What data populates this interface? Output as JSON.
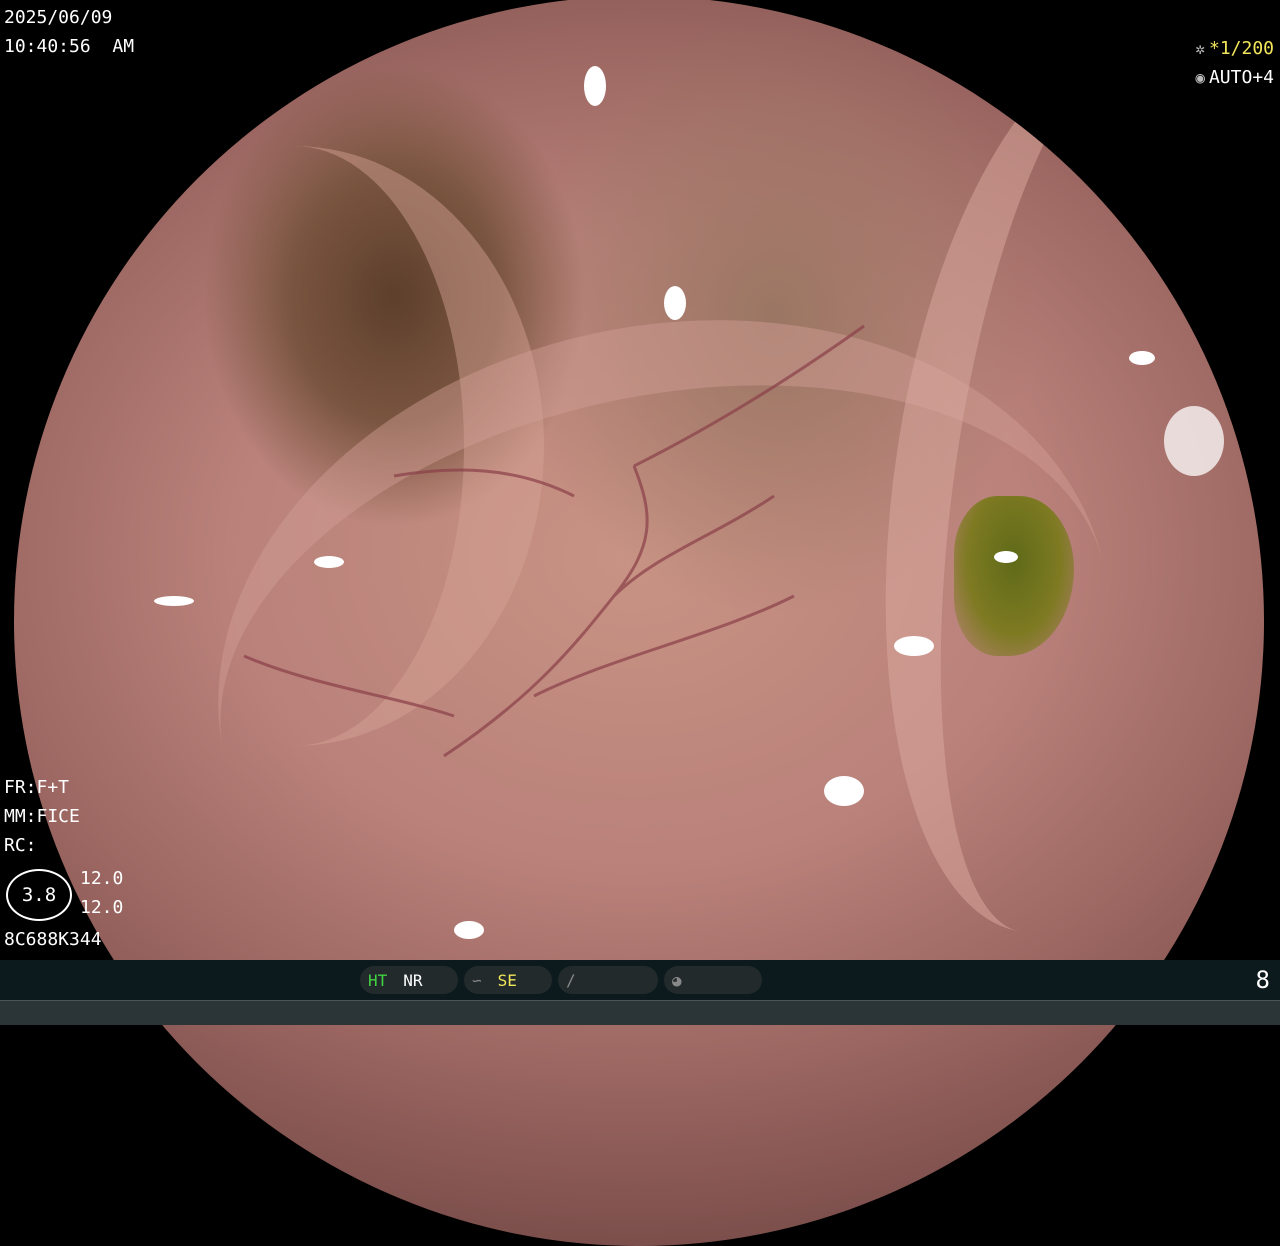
{
  "overlay": {
    "date": "2025/06/09",
    "time": "10:40:56  AM",
    "shutter": "1/200",
    "iris": "AUTO+4",
    "shutter_icon": "aperture-icon",
    "iris_icon": "iris-icon",
    "fr": "FR:F+T",
    "mm": "MM:FICE",
    "rc": "RC:",
    "gauge_value": "3.8",
    "gauge_top": "12.0",
    "gauge_bottom": "12.0",
    "code": "8C688K344"
  },
  "statusbar": {
    "ht": "HT",
    "nr": "NR",
    "se": "SE",
    "page_number": "8",
    "colors": {
      "active": "#42d342",
      "highlight": "#f3e55a"
    }
  }
}
